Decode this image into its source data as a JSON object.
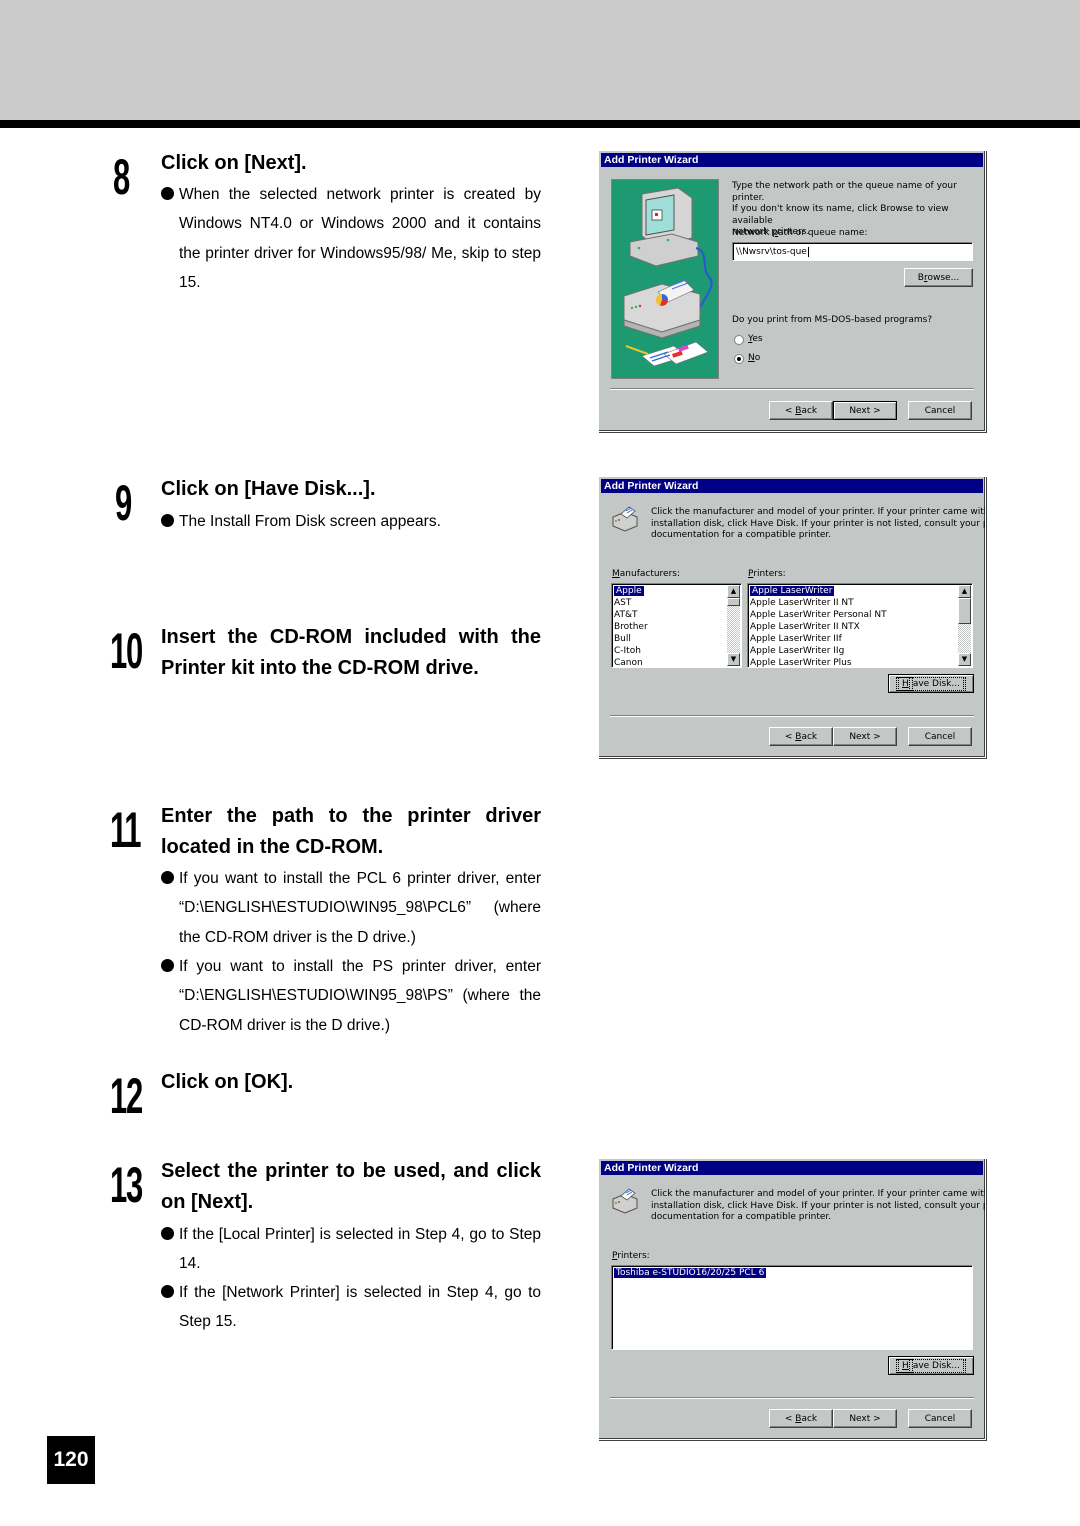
{
  "page": {
    "number": "120"
  },
  "steps": [
    {
      "number": "8",
      "title": "Click on [Next].",
      "bullets": [
        "When the selected network printer is created by Windows NT4.0 or Windows 2000 and it contains the printer driver for Windows95/98/ Me, skip to step 15."
      ]
    },
    {
      "number": "9",
      "title": "Click on [Have Disk...].",
      "bullets": [
        "The Install From Disk screen appears."
      ]
    },
    {
      "number": "10",
      "title": "Insert the CD-ROM included with the Printer kit into the CD-ROM drive.",
      "bullets": []
    },
    {
      "number": "11",
      "title": "Enter the path to the printer driver located in the CD-ROM.",
      "bullets": [
        "If you want to install the PCL 6 printer driver, enter “D:\\ENGLISH\\ESTUDIO\\WIN95_98\\PCL6” (where the CD-ROM driver is the D drive.)",
        "If you want to install the PS printer driver, enter “D:\\ENGLISH\\ESTUDIO\\WIN95_98\\PS” (where the CD-ROM driver is the D drive.)"
      ]
    },
    {
      "number": "12",
      "title": "Click on [OK].",
      "bullets": []
    },
    {
      "number": "13",
      "title": "Select the printer to be used, and click on [Next].",
      "bullets": [
        "If the [Local Printer] is selected in Step 4, go to Step 14.",
        "If the [Network Printer] is selected in Step 4, go to Step 15."
      ]
    }
  ],
  "dialogs": {
    "network_path": {
      "title": "Add Printer Wizard",
      "instruction_lines": [
        "Type the network path or the queue name of your printer.",
        "If you don't know its name, click Browse to view available",
        "network printers."
      ],
      "path_label_pre": "Network ",
      "path_label_u": "p",
      "path_label_post": "ath or queue name:",
      "path_value": "\\\\Nwsrv\\tos-que",
      "browse_pre": "B",
      "browse_u": "r",
      "browse_post": "owse...",
      "msdos_question": "Do you print from MS-DOS-based programs?",
      "radio_yes_u": "Y",
      "radio_yes_rest": "es",
      "radio_no_u": "N",
      "radio_no_rest": "o",
      "selected_option": "No",
      "back_pre": "< ",
      "back_u": "B",
      "back_post": "ack",
      "next_label": "Next >",
      "cancel_label": "Cancel"
    },
    "manufacturer_select": {
      "title": "Add Printer Wizard",
      "instruction_lines": [
        "Click the manufacturer and model of your printer. If your printer came with an",
        "installation disk, click Have Disk. If your printer is not listed, consult your printer",
        "documentation for a compatible printer."
      ],
      "manufacturers_label_u": "M",
      "manufacturers_label_rest": "anufacturers:",
      "manufacturers": [
        "Apple",
        "AST",
        "AT&T",
        "Brother",
        "Bull",
        "C-Itoh",
        "Canon"
      ],
      "selected_manufacturer": "Apple",
      "printers_label_u": "P",
      "printers_label_rest": "rinters:",
      "printers": [
        "Apple LaserWriter",
        "Apple LaserWriter II NT",
        "Apple LaserWriter Personal NT",
        "Apple LaserWriter II NTX",
        "Apple LaserWriter IIf",
        "Apple LaserWriter IIg",
        "Apple LaserWriter Plus"
      ],
      "selected_printer": "Apple LaserWriter",
      "have_disk_u": "H",
      "have_disk_rest": "ave Disk...",
      "back_pre": "< ",
      "back_u": "B",
      "back_post": "ack",
      "next_label": "Next >",
      "cancel_label": "Cancel"
    },
    "printer_select": {
      "title": "Add Printer Wizard",
      "instruction_lines": [
        "Click the manufacturer and model of your printer. If your printer came with an",
        "installation disk, click Have Disk. If your printer is not listed, consult your printer",
        "documentation for a compatible printer."
      ],
      "printers_label_u": "P",
      "printers_label_rest": "rinters:",
      "printers": [
        "Toshiba e-STUDIO16/20/25 PCL 6"
      ],
      "selected_printer": "Toshiba e-STUDIO16/20/25 PCL 6",
      "have_disk_u": "H",
      "have_disk_rest": "ave Disk...",
      "back_pre": "< ",
      "back_u": "B",
      "back_post": "ack",
      "next_label": "Next >",
      "cancel_label": "Cancel"
    }
  },
  "colors": {
    "title_bar": "#000084",
    "dialog_face": "#c3c7c5",
    "illustration_bg": "#1e9a72",
    "header_band": "#cbcbcb"
  }
}
